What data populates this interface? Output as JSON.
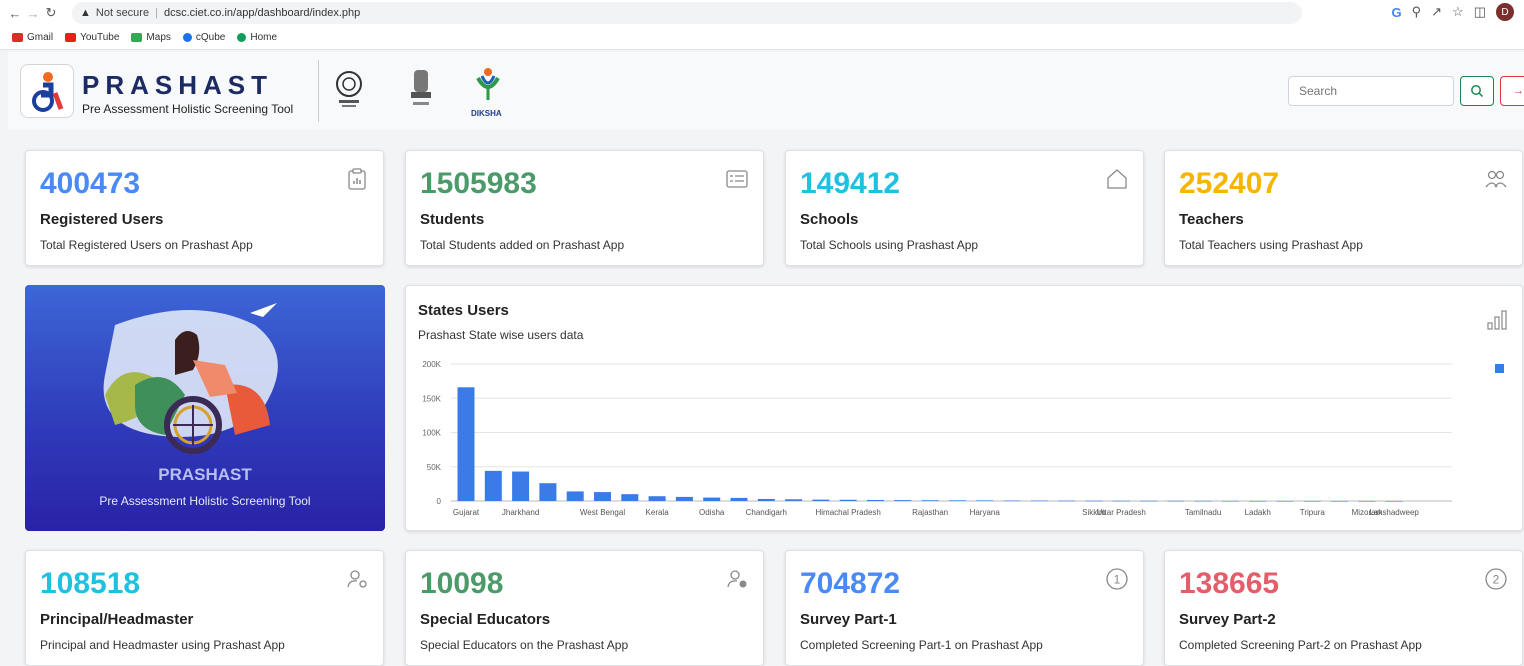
{
  "browser": {
    "security": "Not secure",
    "url": "dcsc.ciet.co.in/app/dashboard/index.php",
    "profile_initial": "D",
    "bookmarks": [
      {
        "label": "Gmail",
        "color": "#d93025"
      },
      {
        "label": "YouTube",
        "color": "#e62117"
      },
      {
        "label": "Maps",
        "color": "#34a853"
      },
      {
        "label": "cQube",
        "color": "#1a73e8"
      },
      {
        "label": "Home",
        "color": "#0f9d58"
      }
    ]
  },
  "header": {
    "brand": "PRASHAST",
    "tagline": "Pre Assessment Holistic Screening Tool",
    "diksha_label": "DIKSHA",
    "search_placeholder": "Search"
  },
  "stats_top": [
    {
      "value": "400473",
      "title": "Registered Users",
      "desc": "Total Registered Users on Prashast App",
      "color": "#4a8af4",
      "icon": "clipboard-chart-icon"
    },
    {
      "value": "1505983",
      "title": "Students",
      "desc": "Total Students added on Prashast App",
      "color": "#4c9a6a",
      "icon": "list-card-icon"
    },
    {
      "value": "149412",
      "title": "Schools",
      "desc": "Total Schools using Prashast App",
      "color": "#1fc0e0",
      "icon": "house-icon"
    },
    {
      "value": "252407",
      "title": "Teachers",
      "desc": "Total Teachers using Prashast App",
      "color": "#f7b500",
      "icon": "people-icon"
    }
  ],
  "stats_bottom": [
    {
      "value": "108518",
      "title": "Principal/Headmaster",
      "desc": "Principal and Headmaster using Prashast App",
      "color": "#1fc0e0",
      "icon": "user-gear-icon"
    },
    {
      "value": "10098",
      "title": "Special Educators",
      "desc": "Special Educators on the Prashast App",
      "color": "#4c9a6a",
      "icon": "user-check-icon"
    },
    {
      "value": "704872",
      "title": "Survey Part-1",
      "desc": "Completed Screening Part-1 on Prashast App",
      "color": "#4a8af4",
      "icon": "circle-1-icon"
    },
    {
      "value": "138665",
      "title": "Survey Part-2",
      "desc": "Completed Screening Part-2 on Prashast App",
      "color": "#e35d6a",
      "icon": "circle-2-icon"
    }
  ],
  "hero": {
    "title": "PRASHAST",
    "subtitle": "Pre Assessment Holistic Screening Tool"
  },
  "chart_panel": {
    "title": "States Users",
    "subtitle": "Prashast State wise users data"
  },
  "chart_data": {
    "type": "bar",
    "ylim": [
      0,
      200000
    ],
    "yticks": [
      {
        "value": 0,
        "label": "0"
      },
      {
        "value": 50000,
        "label": "50K"
      },
      {
        "value": 100000,
        "label": "100K"
      },
      {
        "value": 150000,
        "label": "150K"
      },
      {
        "value": 200000,
        "label": "200K"
      }
    ],
    "categories": [
      "Gujarat",
      "",
      "Jharkhand",
      "",
      "",
      "West Bengal",
      "",
      "Kerala",
      "",
      "Odisha",
      "",
      "Chandigarh",
      "",
      "",
      "Himachal Pradesh",
      "",
      "",
      "Rajasthan",
      "",
      "Haryana",
      "",
      "",
      "",
      "Sikkim",
      "Uttar Pradesh",
      "",
      "",
      "Tamilnadu",
      "",
      "Ladakh",
      "",
      "Tripura",
      "",
      "Mizoram",
      "Lakshadweep"
    ],
    "values": [
      166000,
      44000,
      43000,
      26000,
      14000,
      13000,
      10000,
      7000,
      6000,
      5000,
      4500,
      3000,
      2500,
      2000,
      1800,
      1500,
      1300,
      1100,
      1000,
      900,
      700,
      600,
      500,
      400,
      350,
      300,
      250,
      200,
      150,
      120,
      100,
      80,
      60,
      40,
      20
    ],
    "color": "#3b7be8",
    "grid": true,
    "legend": "right"
  }
}
